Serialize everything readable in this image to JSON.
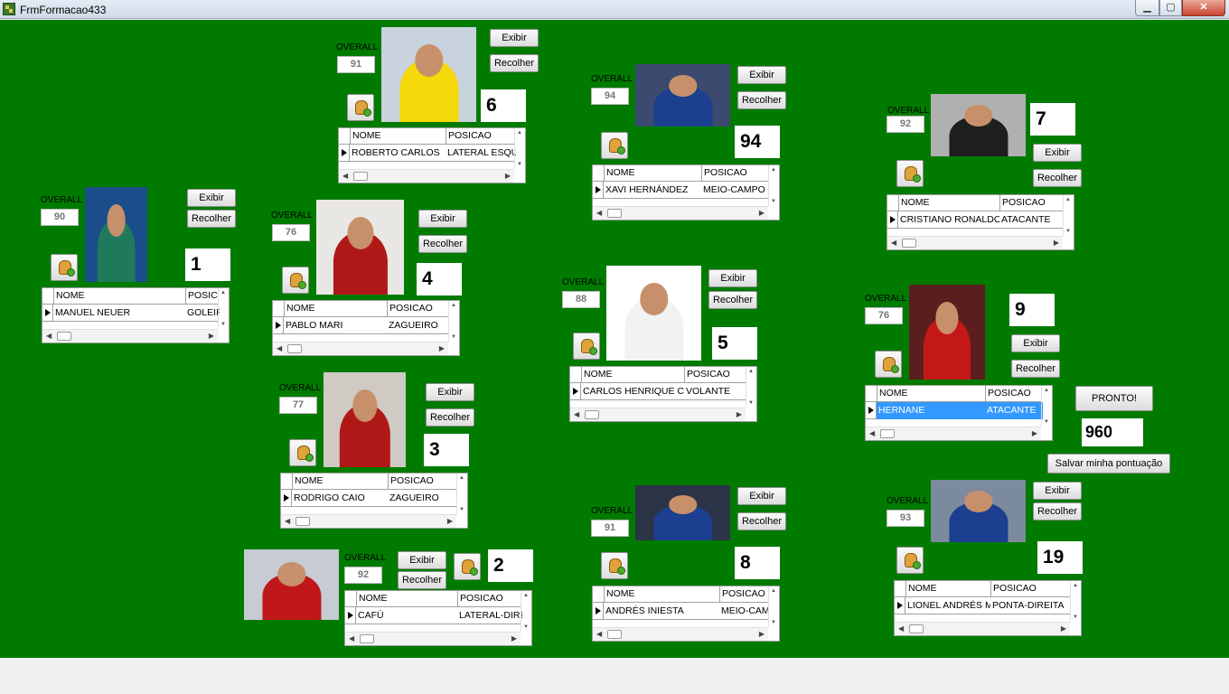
{
  "window": {
    "title": "FrmFormacao433",
    "min_glyph": "▁",
    "max_glyph": "▢",
    "close_glyph": "✕"
  },
  "labels": {
    "overall": "OVERALL",
    "exibir": "Exibir",
    "recolher": "Recolher",
    "col_nome": "NOME",
    "col_posicao": "POSICAO"
  },
  "players": [
    {
      "id": "neuer",
      "overall": "90",
      "number": "1",
      "nome": "MANUEL NEUER",
      "posicao": "GOLEIRO",
      "posicao_header": "POSIC",
      "colors": {
        "bg": "#1a4d8a",
        "kit": "#1f7a5c"
      }
    },
    {
      "id": "roberto",
      "overall": "91",
      "number": "6",
      "nome": "ROBERTO CARLOS",
      "posicao": "LATERAL ESQUERDO",
      "posicao_header": "POSICAO",
      "colors": {
        "bg": "#c9d3dd",
        "kit": "#f5d90a"
      }
    },
    {
      "id": "xavi",
      "overall": "94",
      "number": "94",
      "nome": "XAVI HERNÁNDEZ",
      "posicao": "MEIO-CAMPO",
      "posicao_header": "POSICAO",
      "colors": {
        "bg": "#3b4a6e",
        "kit": "#1c3f8f"
      }
    },
    {
      "id": "cristiano",
      "overall": "92",
      "number": "7",
      "nome": "CRISTIANO RONALDO",
      "posicao": "ATACANTE",
      "posicao_header": "POSICAO",
      "colors": {
        "bg": "#b0b0b0",
        "kit": "#1e1e1e"
      }
    },
    {
      "id": "pablo",
      "overall": "76",
      "number": "4",
      "nome": "PABLO MARI",
      "posicao": "ZAGUEIRO",
      "posicao_header": "POSICAO",
      "colors": {
        "bg": "#e9e7e4",
        "kit": "#b01818"
      }
    },
    {
      "id": "casemiro",
      "overall": "88",
      "number": "5",
      "nome": "CARLOS HENRIQUE CASEMIRO",
      "posicao": "VOLANTE",
      "posicao_header": "POSICAO",
      "colors": {
        "bg": "#ffffff",
        "kit": "#f2f2f2"
      }
    },
    {
      "id": "hernane",
      "overall": "76",
      "number": "9",
      "nome": "HERNANE",
      "posicao": "ATACANTE",
      "posicao_header": "POSICAO",
      "colors": {
        "bg": "#5a1e1e",
        "kit": "#c41818"
      }
    },
    {
      "id": "rodrigo",
      "overall": "77",
      "number": "3",
      "nome": "RODRIGO CAIO",
      "posicao": "ZAGUEIRO",
      "posicao_header": "POSICAO",
      "colors": {
        "bg": "#cfcac3",
        "kit": "#b01818"
      }
    },
    {
      "id": "cafu",
      "overall": "92",
      "number": "2",
      "nome": "CAFÚ",
      "posicao": "LATERAL-DIREITO",
      "posicao_header": "POSICAO",
      "colors": {
        "bg": "#c6cbd4",
        "kit": "#c01818"
      }
    },
    {
      "id": "iniesta",
      "overall": "91",
      "number": "8",
      "nome": "ANDRÉS INIESTA",
      "posicao": "MEIO-CAMPO",
      "posicao_header": "POSICAO",
      "colors": {
        "bg": "#2b3347",
        "kit": "#1c3f8f"
      }
    },
    {
      "id": "messi",
      "overall": "93",
      "number": "19",
      "nome": "LIONEL ANDRÉS MESSI",
      "posicao": "PONTA-DIREITA",
      "posicao_header": "POSICAO",
      "colors": {
        "bg": "#7c8a9e",
        "kit": "#1c3f8f"
      }
    }
  ],
  "actions": {
    "pronto": "PRONTO!",
    "score": "960",
    "salvar": "Salvar minha pontuação"
  },
  "colors": {
    "field": "#007b00",
    "selection": "#3399ff"
  }
}
